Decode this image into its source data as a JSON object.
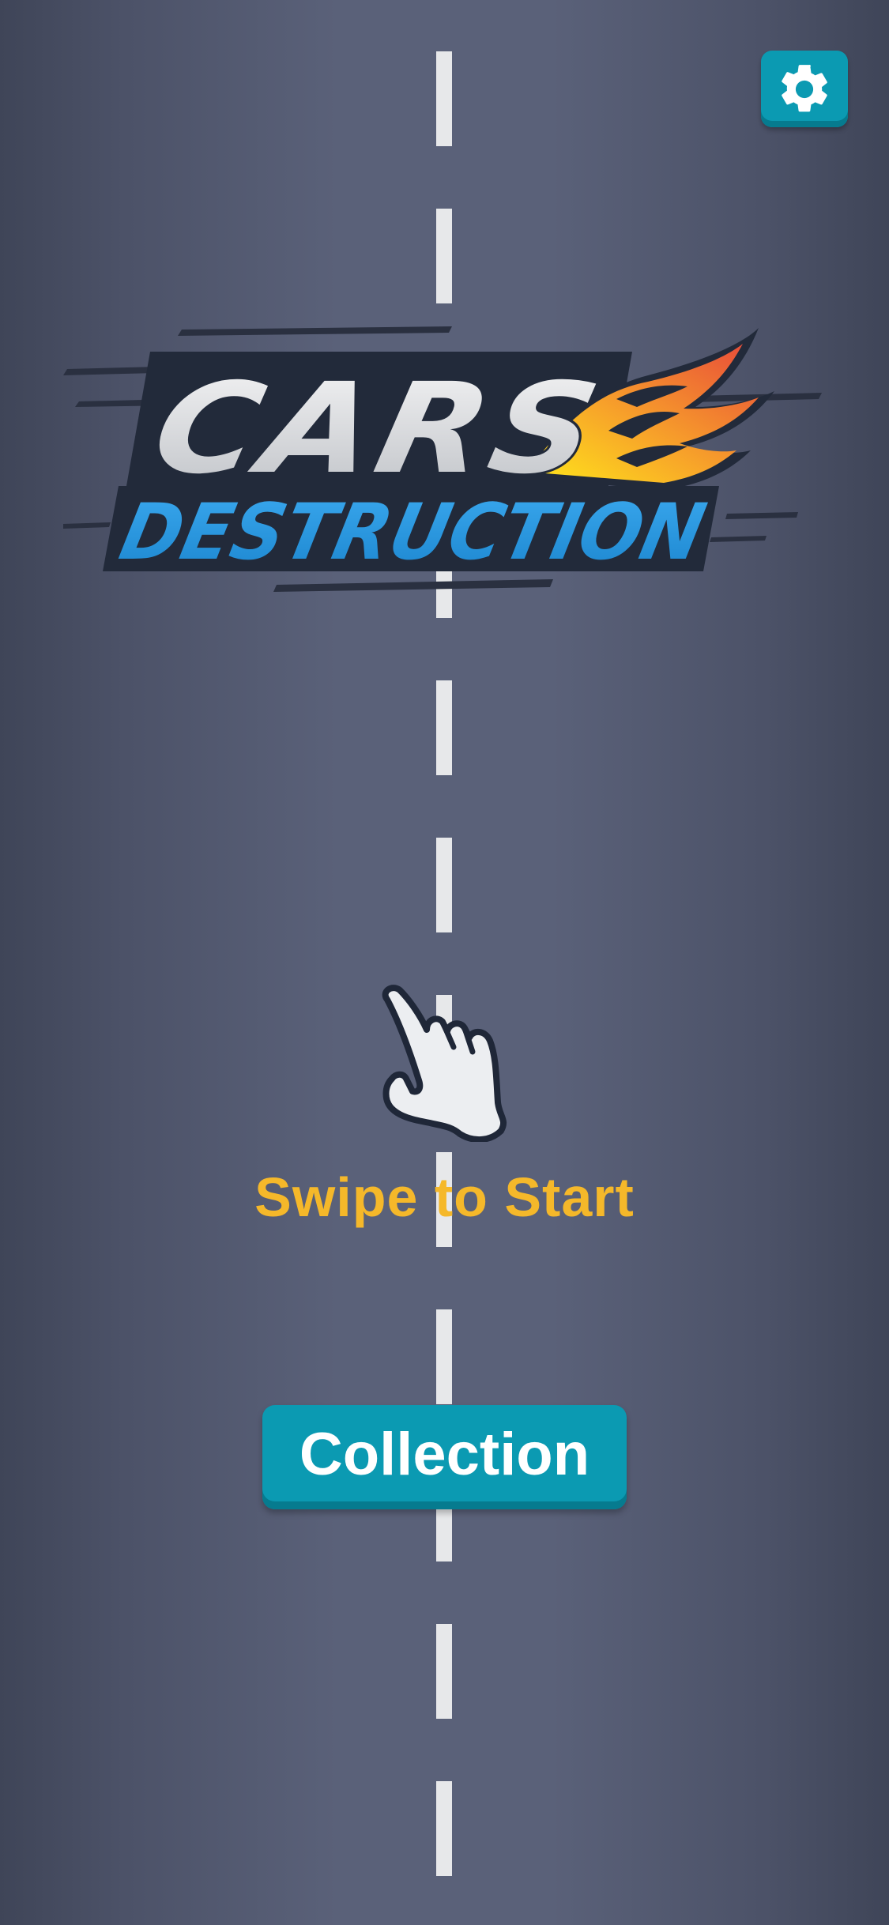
{
  "game": {
    "logo": {
      "line1": "CARS",
      "line2": "DESTRUCTION"
    },
    "prompt_text": "Swipe to Start",
    "collection_label": "Collection",
    "settings_icon": "gear-icon",
    "hand_icon": "pointing-hand-icon"
  },
  "colors": {
    "road": "#5a6179",
    "lane_marking": "#e7e8ea",
    "button": "#0b9ab2",
    "prompt": "#f5b82a",
    "logo_blue": "#2a9be0",
    "logo_silver": "#d9dadd",
    "logo_outline": "#222a3a"
  }
}
